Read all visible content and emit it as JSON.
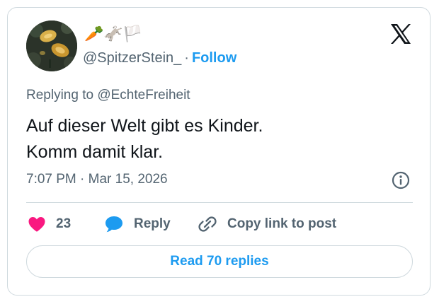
{
  "user": {
    "display_name": "🥕🫏🏳️",
    "handle": "@SpitzerStein_",
    "separator": "·",
    "follow_label": "Follow"
  },
  "icons": {
    "logo": "x-logo-icon",
    "info": "info-icon",
    "like": "heart-icon",
    "reply": "speech-bubble-icon",
    "copy": "link-icon"
  },
  "tweet": {
    "replying_prefix": "Replying to ",
    "replying_to": "@EchteFreiheit",
    "lines": [
      "Auf dieser Welt gibt es Kinder.",
      "Komm damit klar."
    ],
    "timestamp": "7:07 PM · Mar 15, 2026"
  },
  "actions": {
    "like_count": "23",
    "reply_label": "Reply",
    "copy_label": "Copy link to post"
  },
  "footer": {
    "read_replies_label": "Read 70 replies"
  },
  "colors": {
    "accent": "#1d9bf0",
    "like": "#f91880",
    "text": "#0f1419",
    "muted": "#536471",
    "border": "#cfd9de"
  }
}
